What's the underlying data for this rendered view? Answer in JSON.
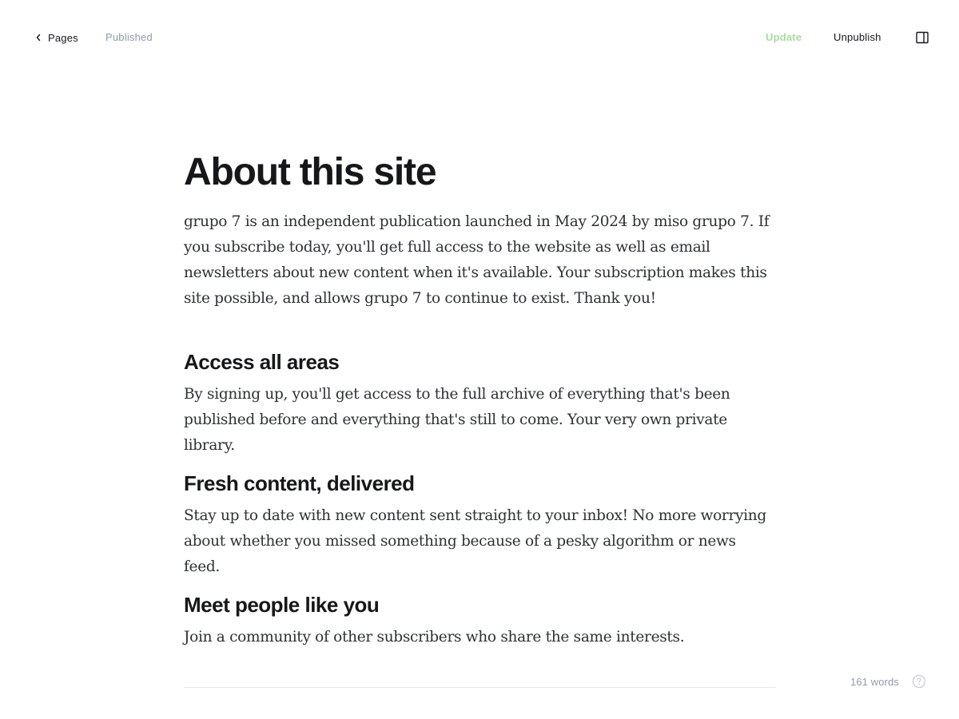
{
  "topbar": {
    "back_label": "Pages",
    "status": "Published",
    "update_label": "Update",
    "unpublish_label": "Unpublish",
    "icons": {
      "back": "chevron-left-icon",
      "sidebar_toggle": "sidebar-panel-icon"
    }
  },
  "editor": {
    "title": "About this site",
    "intro": "grupo 7 is an independent publication launched in May 2024 by miso grupo 7. If you subscribe today, you'll get full access to the website as well as email newsletters about new content when it's available. Your subscription makes this site possible, and allows grupo 7 to continue to exist. Thank you!",
    "sections": [
      {
        "heading": "Access all areas",
        "body": "By signing up, you'll get access to the full archive of everything that's been published before and everything that's still to come. Your very own private library."
      },
      {
        "heading": "Fresh content, delivered",
        "body": "Stay up to date with new content sent straight to your inbox! No more worrying about whether you missed something because of a pesky algorithm or news feed."
      },
      {
        "heading": "Meet people like you",
        "body": "Join a community of other subscribers who share the same interests."
      }
    ]
  },
  "footer": {
    "word_count": "161 words",
    "help_icon": "help-circle-icon"
  },
  "colors": {
    "accent_green": "#a7dca2",
    "muted": "#8e9cac",
    "text": "#15171a",
    "body_text": "#2c3136"
  }
}
